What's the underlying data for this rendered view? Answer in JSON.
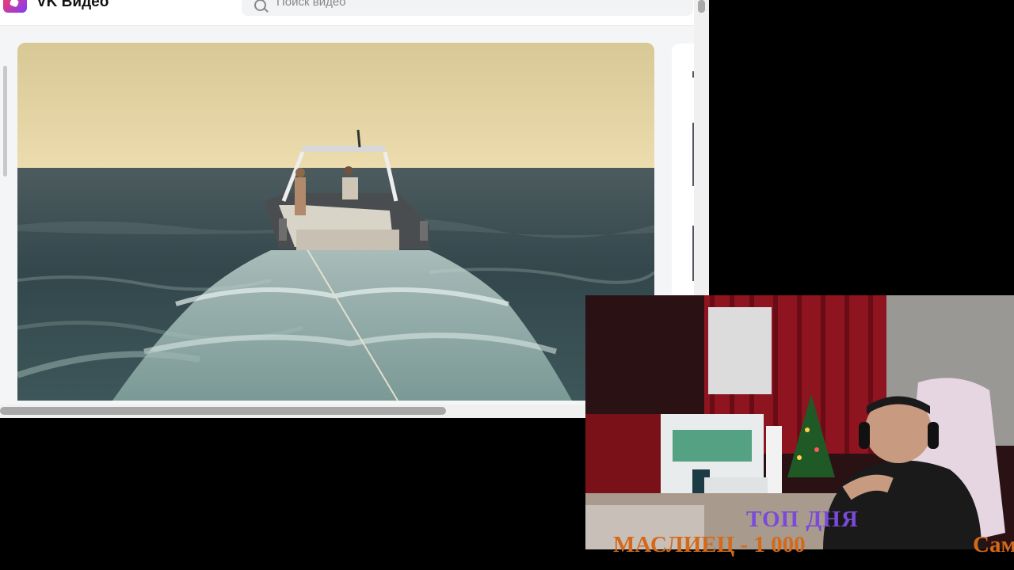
{
  "app": {
    "brand": "VK Видео",
    "logo_icon": "vk-video-logo-icon"
  },
  "search": {
    "placeholder": "Поиск видео",
    "icon": "search-icon"
  },
  "player": {
    "content": "boat-on-sea-video"
  },
  "stream_overlay": {
    "title": "ТОП ДНЯ",
    "line": "МАСЛИЕЦ - 1 000",
    "extra": "Сам"
  },
  "colors": {
    "overlay_title": "#7a4ad8",
    "overlay_line": "#d4691a"
  }
}
